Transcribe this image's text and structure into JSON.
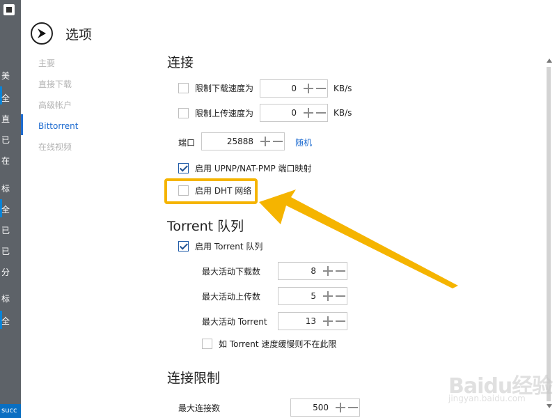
{
  "bg_app": {
    "logo": "app-logo",
    "items": [
      "美",
      "全",
      "直",
      "已",
      "在",
      "标",
      "全",
      "已",
      "已",
      "分",
      "标",
      "全"
    ],
    "status_text": "succ"
  },
  "dialog": {
    "title": "选项",
    "nav": [
      {
        "label": "主要",
        "active": false
      },
      {
        "label": "直接下载",
        "active": false
      },
      {
        "label": "高级帐户",
        "active": false
      },
      {
        "label": "Bittorrent",
        "active": true
      },
      {
        "label": "在线视频",
        "active": false
      }
    ]
  },
  "connection": {
    "title": "连接",
    "limit_download": {
      "label": "限制下载速度为",
      "checked": false,
      "value": "0",
      "unit": "KB/s"
    },
    "limit_upload": {
      "label": "限制上传速度为",
      "checked": false,
      "value": "0",
      "unit": "KB/s"
    },
    "port": {
      "label": "端口",
      "value": "25888",
      "random_label": "随机"
    },
    "upnp": {
      "label": "启用 UPNP/NAT-PMP 端口映射",
      "checked": true
    },
    "dht": {
      "label": "启用 DHT 网络",
      "checked": false
    }
  },
  "queue": {
    "title": "Torrent 队列",
    "enable": {
      "label": "启用 Torrent 队列",
      "checked": true
    },
    "max_download": {
      "label": "最大活动下载数",
      "value": "8"
    },
    "max_upload": {
      "label": "最大活动上传数",
      "value": "5"
    },
    "max_torrent": {
      "label": "最大活动 Torrent",
      "value": "13"
    },
    "slow_exclude": {
      "label": "如 Torrent 速度缓慢则不在此限",
      "checked": false
    }
  },
  "conn_limit": {
    "title": "连接限制",
    "max_connections": {
      "label": "最大连接数",
      "value": "500"
    }
  },
  "watermark": {
    "main": "Baidu经验",
    "sub": "jingyan.baidu.com"
  },
  "colors": {
    "accent": "#1d6bd0",
    "highlight": "#f5b400"
  }
}
